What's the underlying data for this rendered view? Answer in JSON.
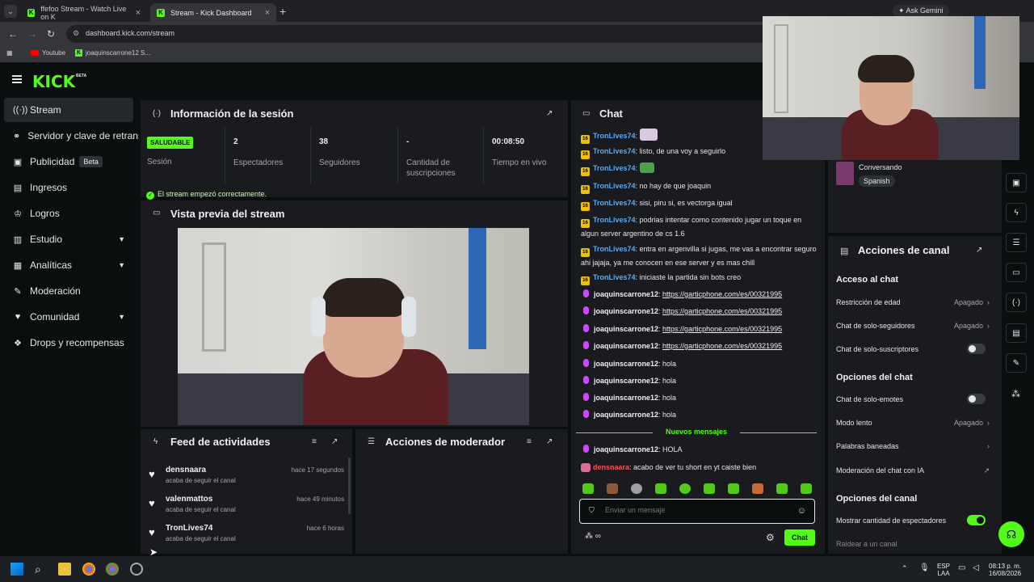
{
  "browser": {
    "tabs": [
      {
        "title": "ffefoo Stream - Watch Live on K"
      },
      {
        "title": "Stream - Kick Dashboard"
      }
    ],
    "ask_button": "Ask Gemini",
    "url": "dashboard.kick.com/stream",
    "bookmarks": [
      "Youtube",
      "joaquinscarrone12 S..."
    ]
  },
  "header": {
    "logo": "KICK",
    "logo_sup": "BETA"
  },
  "sidebar": {
    "items": [
      {
        "label": "Stream",
        "icon": "broadcast-icon"
      },
      {
        "label": "Servidor y clave de retransmisión",
        "icon": "link-icon"
      },
      {
        "label": "Publicidad",
        "badge": "Beta",
        "icon": "ad-icon"
      },
      {
        "label": "Ingresos",
        "icon": "money-icon"
      },
      {
        "label": "Logros",
        "icon": "trophy-icon"
      },
      {
        "label": "Estudio",
        "icon": "studio-icon"
      },
      {
        "label": "Analíticas",
        "icon": "chart-icon"
      },
      {
        "label": "Moderación",
        "icon": "wrench-icon"
      },
      {
        "label": "Comunidad",
        "icon": "community-icon"
      },
      {
        "label": "Drops y recompensas",
        "icon": "gift-icon"
      }
    ]
  },
  "session": {
    "title": "Información de la sesión",
    "status_badge": "SALUDABLE",
    "status_label": "Sesión",
    "viewers": {
      "value": "2",
      "label": "Espectadores"
    },
    "followers": {
      "value": "38",
      "label": "Seguidores"
    },
    "subs": {
      "value": "-",
      "label": "Cantidad de suscripciones"
    },
    "uptime": {
      "value": "00:08:50",
      "label": "Tiempo en vivo"
    },
    "notice": "El stream empezó correctamente."
  },
  "preview": {
    "title": "Vista previa del stream"
  },
  "feed": {
    "title": "Feed de actividades",
    "items": [
      {
        "name": "densnaara",
        "action": "acaba de seguir el canal",
        "time": "hace 17 segundos"
      },
      {
        "name": "valenmattos",
        "action": "acaba de seguir el canal",
        "time": "hace 49 minutos"
      },
      {
        "name": "TronLives74",
        "action": "acaba de seguir el canal",
        "time": "hace 6 horas"
      }
    ]
  },
  "mod_actions": {
    "title": "Acciones de moderador"
  },
  "chat": {
    "title": "Chat",
    "messages": [
      {
        "user": "TronLives74",
        "text": ""
      },
      {
        "user": "TronLives74",
        "text": "listo, de una voy a seguirlo"
      },
      {
        "user": "TronLives74",
        "text": ""
      },
      {
        "user": "TronLives74",
        "text": "no hay de que joaquin"
      },
      {
        "user": "TronLives74",
        "text": "sisi, piru si, es vectorga igual"
      },
      {
        "user": "TronLives74",
        "text": "podrias intentar como contenido jugar un toque en algun server argentino de cs 1.6"
      },
      {
        "user": "TronLives74",
        "text": "entra en argenvilla si jugas, me vas a encontrar seguro ahi jajaja, ya me conocen en ese server y es mas chill"
      },
      {
        "user": "TronLives74",
        "text": "iniciaste la partida sin bots creo"
      },
      {
        "user": "joaquinscarrone12",
        "text": "https://garticphone.com/es/00321995"
      },
      {
        "user": "joaquinscarrone12",
        "text": "https://garticphone.com/es/00321995"
      },
      {
        "user": "joaquinscarrone12",
        "text": "https://garticphone.com/es/00321995"
      },
      {
        "user": "joaquinscarrone12",
        "text": "https://garticphone.com/es/00321995"
      },
      {
        "user": "joaquinscarrone12",
        "text": "hola"
      },
      {
        "user": "joaquinscarrone12",
        "text": "hola"
      },
      {
        "user": "joaquinscarrone12",
        "text": "hola"
      },
      {
        "user": "joaquinscarrone12",
        "text": "hola"
      }
    ],
    "new_messages": "Nuevos mensajes",
    "new": [
      {
        "user": "joaquinscarrone12",
        "text": "HOLA"
      },
      {
        "user": "densnaara",
        "text": "acabo de ver tu short en yt caiste bien"
      }
    ],
    "badge_text": "16",
    "input_placeholder": "Enviar un mensaje",
    "send_label": "Chat"
  },
  "stream_info": {
    "category": "Conversando",
    "language": "Spanish"
  },
  "channel_actions": {
    "title": "Acciones de canal",
    "chat_access": "Acceso al chat",
    "age_restriction": {
      "label": "Restricción de edad",
      "value": "Apagado"
    },
    "followers_only": {
      "label": "Chat de solo-seguidores",
      "value": "Apagado"
    },
    "subs_only": {
      "label": "Chat de solo-suscriptores"
    },
    "chat_options": "Opciones del chat",
    "emotes_only": {
      "label": "Chat de solo-emotes"
    },
    "slow_mode": {
      "label": "Modo lento",
      "value": "Apagado"
    },
    "banned_words": {
      "label": "Palabras baneadas"
    },
    "ai_moderation": {
      "label": "Moderación del chat con IA"
    },
    "channel_options": "Opciones del canal",
    "show_viewers": {
      "label": "Mostrar cantidad de espectadores",
      "enabled": true
    },
    "raid": {
      "label": "Raidear a un canal"
    }
  },
  "taskbar": {
    "lang": "ESP",
    "lang2": "LAA",
    "time": "08:13 p. m.",
    "date": "16/08/2026"
  },
  "colors": {
    "accent": "#53fc18",
    "panel": "#191b1f",
    "bg": "#0b0e0f"
  }
}
